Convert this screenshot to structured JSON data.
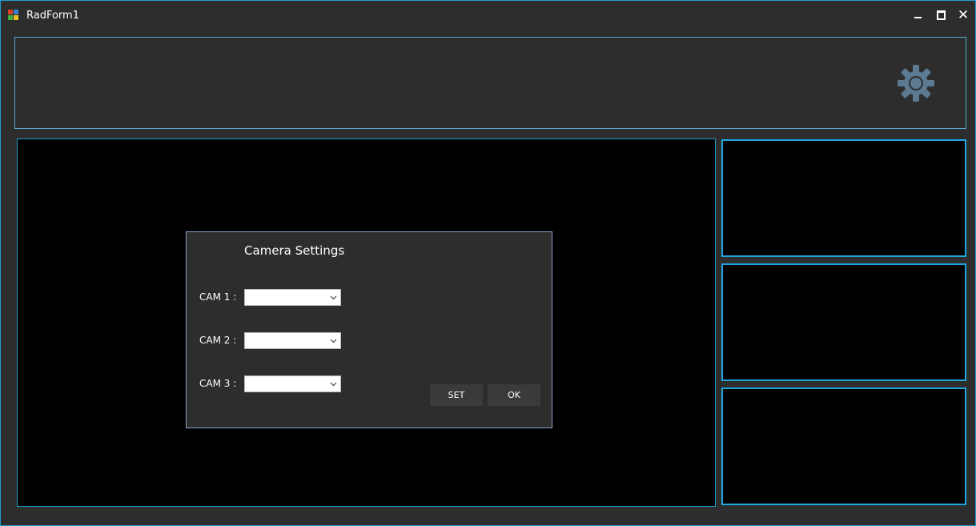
{
  "window": {
    "title": "RadForm1",
    "app_icon": "app-form-icon",
    "controls": {
      "minimize_icon": "minimize-icon",
      "maximize_icon": "maximize-icon",
      "close_label": "✕"
    }
  },
  "toolbar": {
    "settings_icon": "gear-icon"
  },
  "views": {
    "main": "main-camera-view",
    "side": [
      "side-camera-view-1",
      "side-camera-view-2",
      "side-camera-view-3"
    ]
  },
  "dialog": {
    "title": "Camera Settings",
    "cams": [
      {
        "label": "CAM 1 :",
        "value": ""
      },
      {
        "label": "CAM 2 :",
        "value": ""
      },
      {
        "label": "CAM 3 :",
        "value": ""
      }
    ],
    "set_label": "SET",
    "ok_label": "OK"
  },
  "colors": {
    "background": "#2d2d2d",
    "accent_border": "#1e9fd0",
    "gear": "#5c7a92",
    "video": "#000000"
  }
}
